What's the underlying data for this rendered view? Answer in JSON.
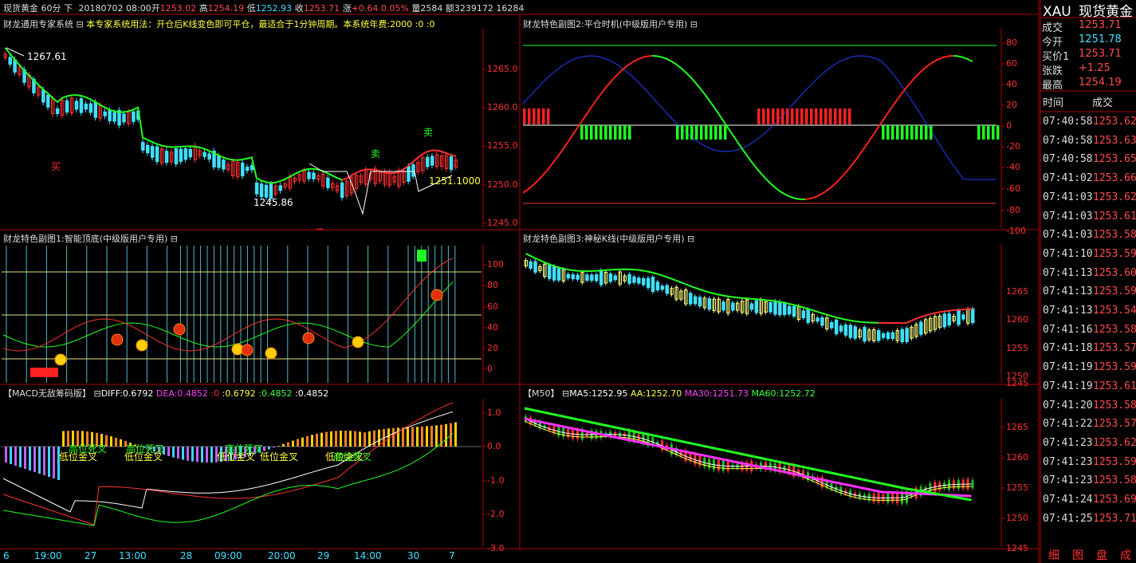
{
  "header": {
    "symbol_period": "现货黄金 60分 下",
    "date": "20180702 08:00",
    "open_label": "开",
    "open_value": "1253.02",
    "high_label": "高",
    "high_value": "1254.19",
    "low_label": "低",
    "low_value": "1252.93",
    "close_label": "收",
    "close_value": "1253.71",
    "change_label": "涨",
    "change_value": "+0.64 0.05%",
    "volume_label": "量",
    "volume_value": "2584",
    "amount_label": "额",
    "amount_value": "3239172 16284"
  },
  "main_panel": {
    "title": "财龙通用专家系统",
    "usage": "本专家系统用法：开仓后K线变色即可平仓，最适合于1分钟周期。本系统年费:2000 :0 :0",
    "label_high": "1267.61",
    "label_low": "1245.86",
    "label_last": "1251.1000",
    "signal_buy": "买",
    "signal_sell1": "卖",
    "signal_sell2": "卖",
    "signal_buy2": "买",
    "axis": [
      "1265.0",
      "1260.0",
      "1255.0",
      "1250.0",
      "1245.0"
    ]
  },
  "sub1_panel": {
    "title": "财龙特色副图1:智能顶底(中级版用户专用)",
    "axis": [
      "100",
      "80",
      "60",
      "40",
      "20",
      "0"
    ]
  },
  "macd_panel": {
    "title": "【MACD无敌筹码版】",
    "diff": "DIFF:0.6792",
    "dea": "DEA:0.4852",
    "v0": ":0",
    "v1": ":0.6792",
    "v2": ":0.4852",
    "v3": ":0.4852",
    "labels": [
      "低位金叉",
      "低位金叉",
      "低位金叉",
      "低位金叉",
      "低位金叉"
    ],
    "labels2": [
      "高位死叉",
      "高位死叉",
      "高位死叉",
      "高位死叉"
    ],
    "axis": [
      "1.0",
      "0.0",
      "-1.0",
      "-2.0",
      "-3.0"
    ]
  },
  "sub2_panel": {
    "title": "财龙特色副图2:平仓时机(中级版用户专用)",
    "axis": [
      "80",
      "60",
      "40",
      "20",
      "0",
      "-20",
      "-40",
      "-60",
      "-80",
      "-100"
    ]
  },
  "sub3_panel": {
    "title": "财龙特色副图3:神秘K线(中级版用户专用)",
    "axis": [
      "1265",
      "1260",
      "1255",
      "1250",
      "1245"
    ]
  },
  "ma_panel": {
    "title": "【M50】",
    "ma5": "MA5:1252.95",
    "aa": "AA:1252.70",
    "ma30": "MA30:1251.73",
    "ma60": "MA60:1252.72",
    "axis": [
      "1265",
      "1260",
      "1255",
      "1250",
      "1245"
    ]
  },
  "x_axis": [
    "6",
    "19:00",
    "27",
    "13:00",
    "28",
    "09:00",
    "20:00",
    "29",
    "14:00",
    "30",
    "7"
  ],
  "quote": {
    "code": "XAU",
    "name": "现货黄金",
    "rows": [
      {
        "label": "成交",
        "value": "1253.71",
        "color": "#ff4b4b"
      },
      {
        "label": "今开",
        "value": "1251.78",
        "color": "#40e0ff"
      },
      {
        "label": "买价1",
        "value": "1253.71",
        "color": "#ff4b4b"
      },
      {
        "label": "张跌",
        "value": "+1.25",
        "color": "#ff4b4b"
      },
      {
        "label": "最高",
        "value": "1254.19",
        "color": "#ff4b4b"
      }
    ],
    "tick_header": {
      "time": "时间",
      "price": "成交"
    },
    "ticks": [
      {
        "time": "07:40:58",
        "price": "1253.62"
      },
      {
        "time": "07:40:58",
        "price": "1253.63"
      },
      {
        "time": "07:40:58",
        "price": "1253.65"
      },
      {
        "time": "07:41:02",
        "price": "1253.66"
      },
      {
        "time": "07:41:03",
        "price": "1253.62"
      },
      {
        "time": "07:41:03",
        "price": "1253.61"
      },
      {
        "time": "07:41:03",
        "price": "1253.58"
      },
      {
        "time": "07:41:10",
        "price": "1253.59"
      },
      {
        "time": "07:41:13",
        "price": "1253.60"
      },
      {
        "time": "07:41:13",
        "price": "1253.59"
      },
      {
        "time": "07:41:13",
        "price": "1253.54"
      },
      {
        "time": "07:41:16",
        "price": "1253.58"
      },
      {
        "time": "07:41:18",
        "price": "1253.57"
      },
      {
        "time": "07:41:19",
        "price": "1253.59"
      },
      {
        "time": "07:41:19",
        "price": "1253.61"
      },
      {
        "time": "07:41:20",
        "price": "1253.58"
      },
      {
        "time": "07:41:22",
        "price": "1253.57"
      },
      {
        "time": "07:41:23",
        "price": "1253.62"
      },
      {
        "time": "07:41:23",
        "price": "1253.59"
      },
      {
        "time": "07:41:23",
        "price": "1253.58"
      },
      {
        "time": "07:41:24",
        "price": "1253.69"
      },
      {
        "time": "07:41:25",
        "price": "1253.71"
      }
    ],
    "bottom_tabs": [
      "细",
      "图",
      "盘",
      "成"
    ]
  }
}
